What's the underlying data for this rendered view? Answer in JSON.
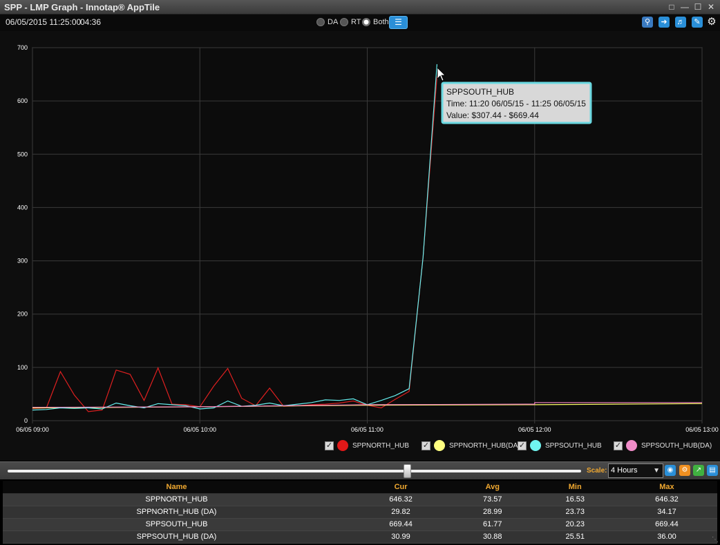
{
  "window": {
    "title": "SPP - LMP Graph - Innotap® AppTile",
    "controls": [
      "restore-icon",
      "minimize-icon",
      "maximize-icon",
      "close-icon"
    ]
  },
  "info": {
    "datetime": "06/05/2015 11:25:00",
    "elapsed": "04:36",
    "modes": [
      {
        "label": "DA",
        "selected": false
      },
      {
        "label": "RT",
        "selected": false
      },
      {
        "label": "Both",
        "selected": true
      }
    ],
    "toolbar_icons": [
      "zoom-icon",
      "forward-icon",
      "sound-icon",
      "edit-icon",
      "settings-gear-icon"
    ]
  },
  "chart_data": {
    "type": "line",
    "x_ticks": [
      "06/05 09:00",
      "06/05 10:00",
      "06/05 11:00",
      "06/05 12:00",
      "06/05 13:00"
    ],
    "y_ticks": [
      0,
      100,
      200,
      300,
      400,
      500,
      600,
      700
    ],
    "xlim": [
      "06/05 09:00",
      "06/05 13:00"
    ],
    "ylim": [
      0,
      700
    ],
    "grid": true,
    "legend_position": "bottom-right",
    "series": [
      {
        "name": "SPPNORTH_HUB",
        "color": "#e02020",
        "x": [
          "09:00",
          "09:05",
          "09:10",
          "09:15",
          "09:20",
          "09:25",
          "09:30",
          "09:35",
          "09:40",
          "09:45",
          "09:50",
          "09:55",
          "10:00",
          "10:05",
          "10:10",
          "10:15",
          "10:20",
          "10:25",
          "10:30",
          "10:35",
          "10:40",
          "10:45",
          "10:50",
          "10:55",
          "11:00",
          "11:05",
          "11:10",
          "11:15",
          "11:20",
          "11:25"
        ],
        "values": [
          23,
          24,
          92,
          48,
          17,
          20,
          95,
          87,
          38,
          99,
          31,
          30,
          26,
          65,
          98,
          42,
          28,
          61,
          27,
          28,
          30,
          31,
          33,
          37,
          29,
          24,
          40,
          55,
          307,
          646
        ]
      },
      {
        "name": "SPPNORTH_HUB(DA)",
        "color": "#ffff66",
        "x": [
          "09:00",
          "10:00",
          "11:00",
          "12:00",
          "13:00"
        ],
        "values": [
          24,
          26,
          29,
          30,
          32
        ]
      },
      {
        "name": "SPPSOUTH_HUB",
        "color": "#66f0f0",
        "x": [
          "09:00",
          "09:05",
          "09:10",
          "09:15",
          "09:20",
          "09:25",
          "09:30",
          "09:35",
          "09:40",
          "09:45",
          "09:50",
          "09:55",
          "10:00",
          "10:05",
          "10:10",
          "10:15",
          "10:20",
          "10:25",
          "10:30",
          "10:35",
          "10:40",
          "10:45",
          "10:50",
          "10:55",
          "11:00",
          "11:05",
          "11:10",
          "11:15",
          "11:20",
          "11:25"
        ],
        "values": [
          20,
          21,
          24,
          23,
          24,
          22,
          33,
          28,
          24,
          32,
          30,
          28,
          22,
          24,
          37,
          27,
          29,
          33,
          28,
          31,
          34,
          39,
          38,
          41,
          30,
          38,
          47,
          60,
          307,
          669
        ]
      },
      {
        "name": "SPPSOUTH_HUB(DA)",
        "color": "#f080c0",
        "x": [
          "09:00",
          "10:00",
          "11:00",
          "12:00",
          "12:00",
          "13:00"
        ],
        "values": [
          25,
          26,
          30,
          31,
          34,
          34
        ]
      }
    ],
    "tooltip": {
      "title": "SPPSOUTH_HUB",
      "time": "Time: 11:20 06/05/15 - 11:25 06/05/15",
      "value": "Value: $307.44 - $669.44"
    }
  },
  "legend": [
    {
      "label": "SPPNORTH_HUB",
      "color": "#e01818",
      "checked": true
    },
    {
      "label": "SPPNORTH_HUB(DA)",
      "color": "#ffff80",
      "checked": true
    },
    {
      "label": "SPPSOUTH_HUB",
      "color": "#70f4f0",
      "checked": true
    },
    {
      "label": "SPPSOUTH_HUB(DA)",
      "color": "#f08cc8",
      "checked": true
    }
  ],
  "slider": {
    "position": 0.69,
    "scale_label": "Scale:",
    "scale_value": "4 Hours",
    "icons": [
      "eye-icon",
      "settings-icon",
      "chart-icon",
      "layout-icon"
    ]
  },
  "stats": {
    "headers": [
      "Name",
      "Cur",
      "Avg",
      "Min",
      "Max"
    ],
    "rows": [
      [
        "SPPNORTH_HUB",
        "646.32",
        "73.57",
        "16.53",
        "646.32"
      ],
      [
        "SPPNORTH_HUB (DA)",
        "29.82",
        "28.99",
        "23.73",
        "34.17"
      ],
      [
        "SPPSOUTH_HUB",
        "669.44",
        "61.77",
        "20.23",
        "669.44"
      ],
      [
        "SPPSOUTH_HUB (DA)",
        "30.99",
        "30.88",
        "25.51",
        "36.00"
      ]
    ]
  }
}
